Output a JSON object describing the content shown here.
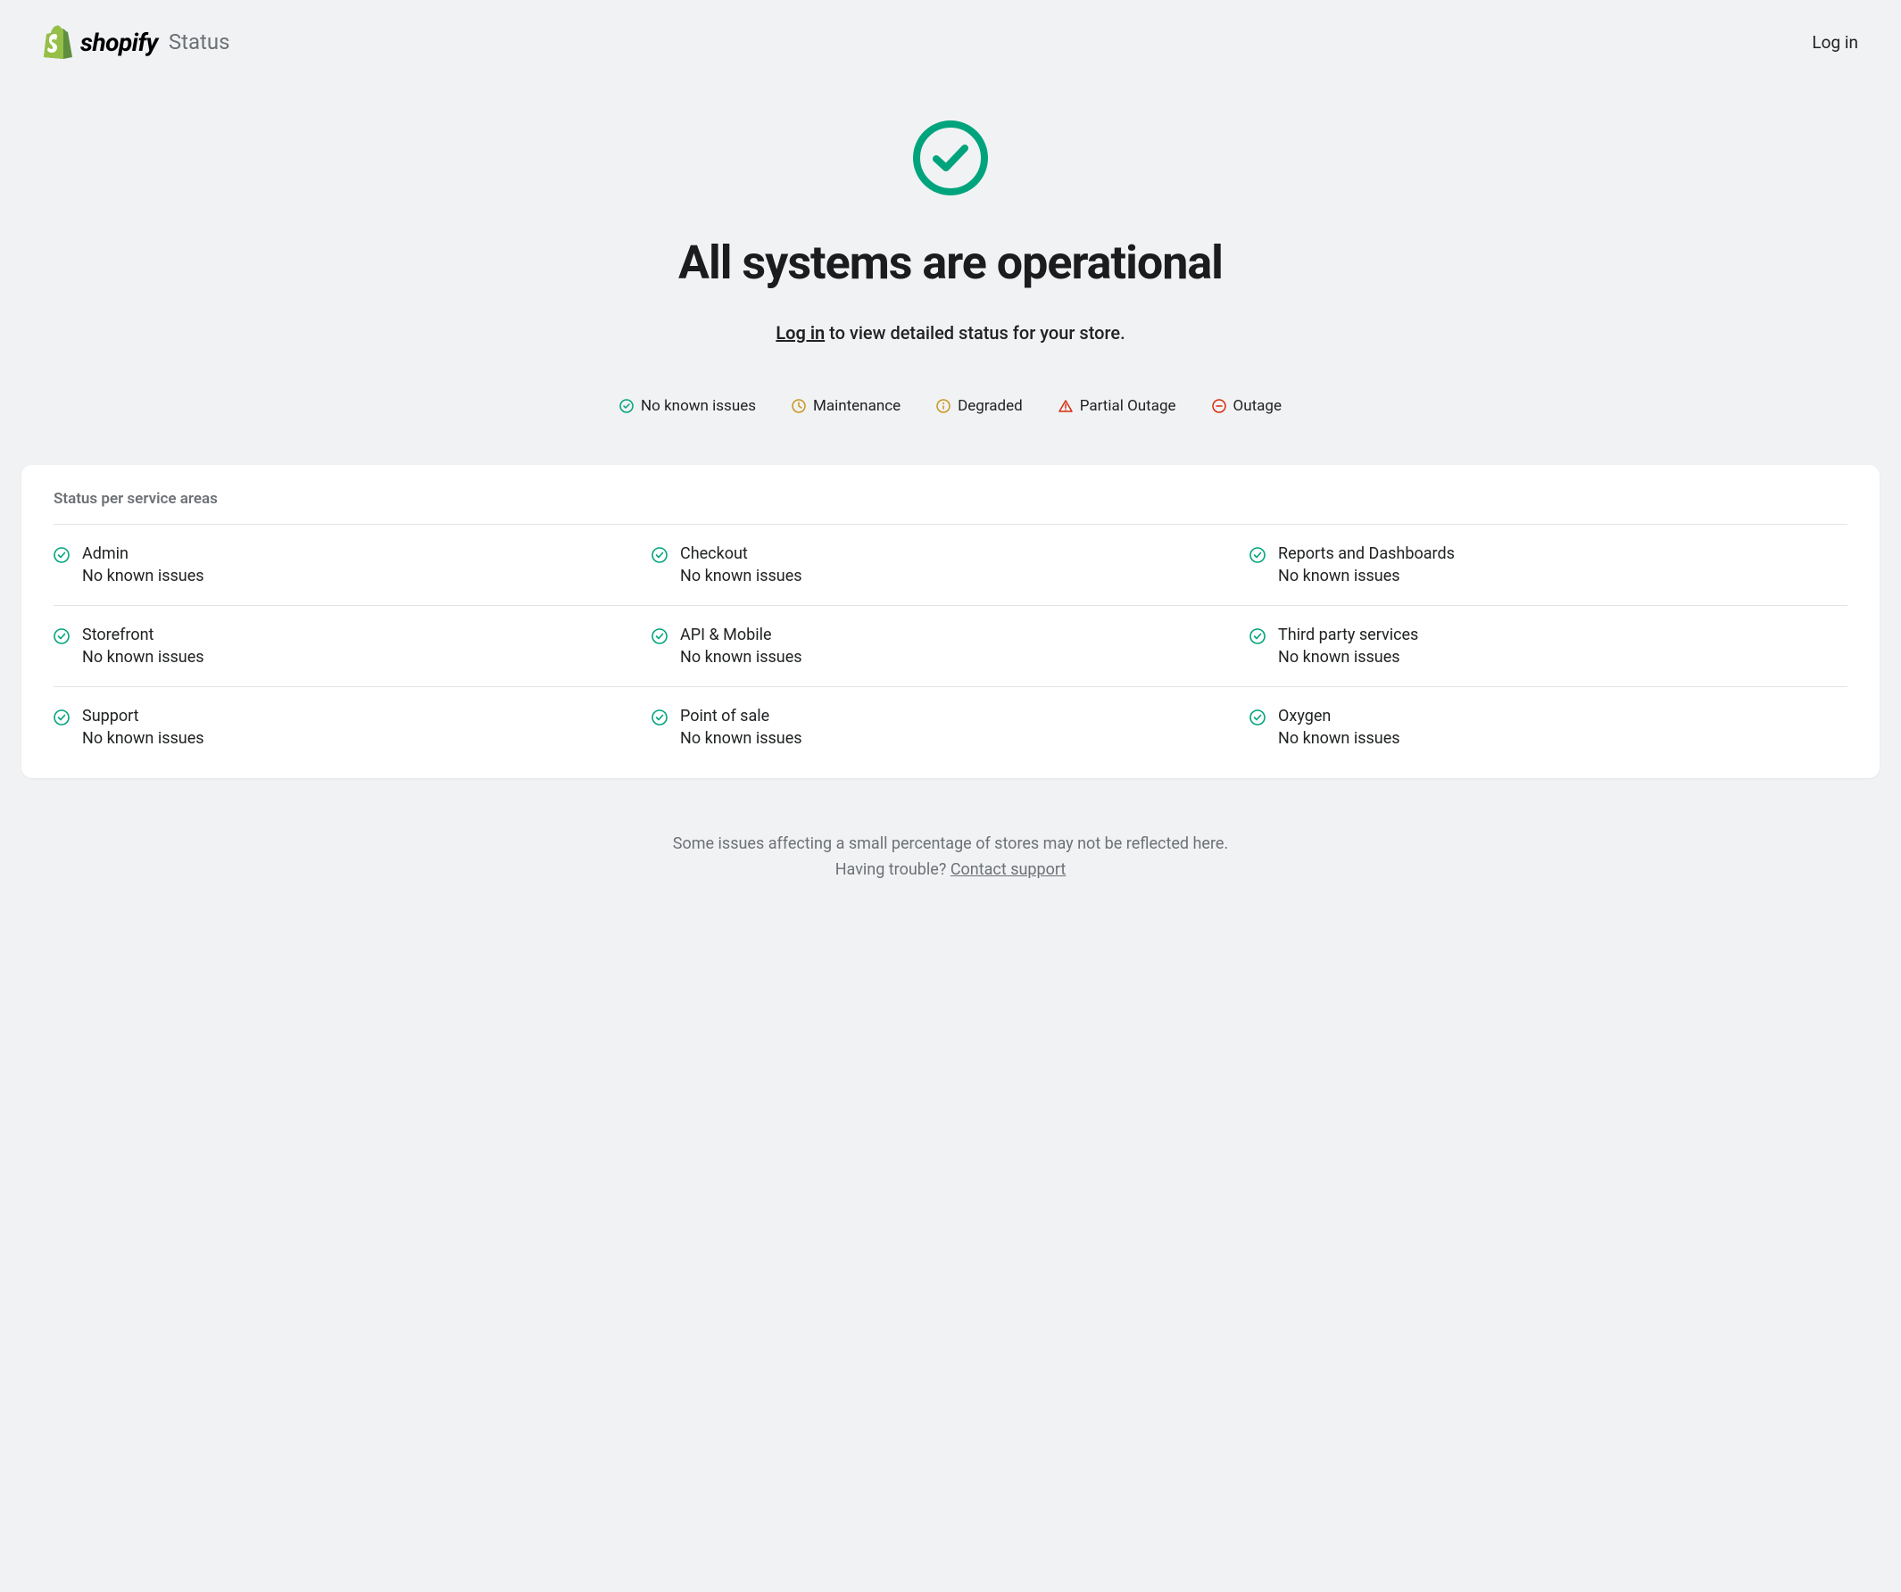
{
  "header": {
    "brand": "shopify",
    "suffix": "Status",
    "login": "Log in"
  },
  "hero": {
    "title": "All systems are operational",
    "login_link": "Log in",
    "subtitle_rest": " to view detailed status for your store."
  },
  "legend": {
    "no_issues": "No known issues",
    "maintenance": "Maintenance",
    "degraded": "Degraded",
    "partial_outage": "Partial Outage",
    "outage": "Outage"
  },
  "card": {
    "title": "Status per service areas"
  },
  "services": [
    {
      "name": "Admin",
      "status": "No known issues"
    },
    {
      "name": "Checkout",
      "status": "No known issues"
    },
    {
      "name": "Reports and Dashboards",
      "status": "No known issues"
    },
    {
      "name": "Storefront",
      "status": "No known issues"
    },
    {
      "name": "API & Mobile",
      "status": "No known issues"
    },
    {
      "name": "Third party services",
      "status": "No known issues"
    },
    {
      "name": "Support",
      "status": "No known issues"
    },
    {
      "name": "Point of sale",
      "status": "No known issues"
    },
    {
      "name": "Oxygen",
      "status": "No known issues"
    }
  ],
  "footer": {
    "line1": "Some issues affecting a small percentage of stores may not be reflected here.",
    "line2_prefix": "Having trouble? ",
    "line2_link": "Contact support"
  }
}
